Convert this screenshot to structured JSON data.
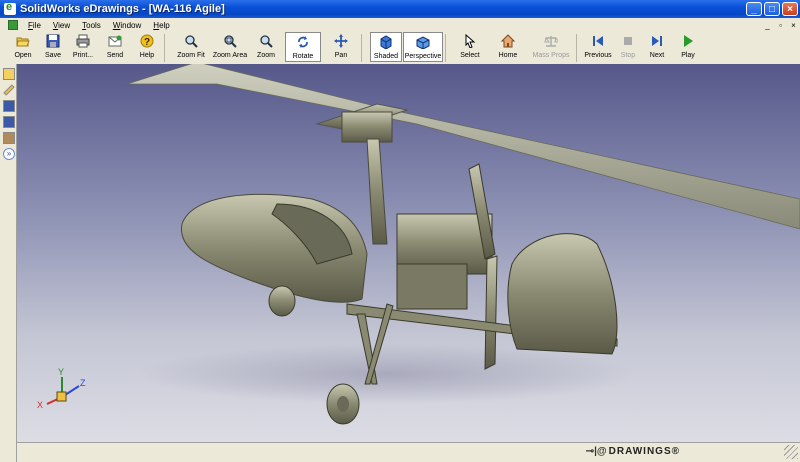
{
  "window": {
    "title": "SolidWorks eDrawings - [WA-116 Agile]"
  },
  "menu": [
    "File",
    "View",
    "Tools",
    "Window",
    "Help"
  ],
  "toolbar": [
    {
      "label": "Open",
      "icon": "folder-open-icon"
    },
    {
      "label": "Save",
      "icon": "floppy-disk-icon"
    },
    {
      "label": "Print...",
      "icon": "printer-icon"
    },
    {
      "label": "Send",
      "icon": "envelope-icon"
    },
    {
      "label": "Help",
      "icon": "question-icon"
    },
    {
      "label": "Zoom Fit",
      "icon": "magnifier-fit-icon"
    },
    {
      "label": "Zoom Area",
      "icon": "magnifier-area-icon"
    },
    {
      "label": "Zoom",
      "icon": "magnifier-icon"
    },
    {
      "label": "Rotate",
      "icon": "rotate-icon"
    },
    {
      "label": "Pan",
      "icon": "pan-arrows-icon"
    },
    {
      "label": "Shaded",
      "icon": "shaded-cube-icon"
    },
    {
      "label": "Perspective",
      "icon": "perspective-cube-icon"
    },
    {
      "label": "Select",
      "icon": "cursor-icon"
    },
    {
      "label": "Home",
      "icon": "home-icon"
    },
    {
      "label": "Mass Props",
      "icon": "scale-icon"
    },
    {
      "label": "Previous",
      "icon": "previous-icon"
    },
    {
      "label": "Stop",
      "icon": "stop-icon"
    },
    {
      "label": "Next",
      "icon": "next-icon"
    },
    {
      "label": "Play",
      "icon": "play-icon"
    }
  ],
  "triad": {
    "x": "X",
    "y": "Y",
    "z": "Z"
  },
  "status": {
    "brand": "DRAWINGS®"
  },
  "colors": {
    "titlebar": "#0a50d8",
    "viewport_top": "#56588a",
    "viewport_bottom": "#dcdde4",
    "model": "#8a8a72"
  }
}
